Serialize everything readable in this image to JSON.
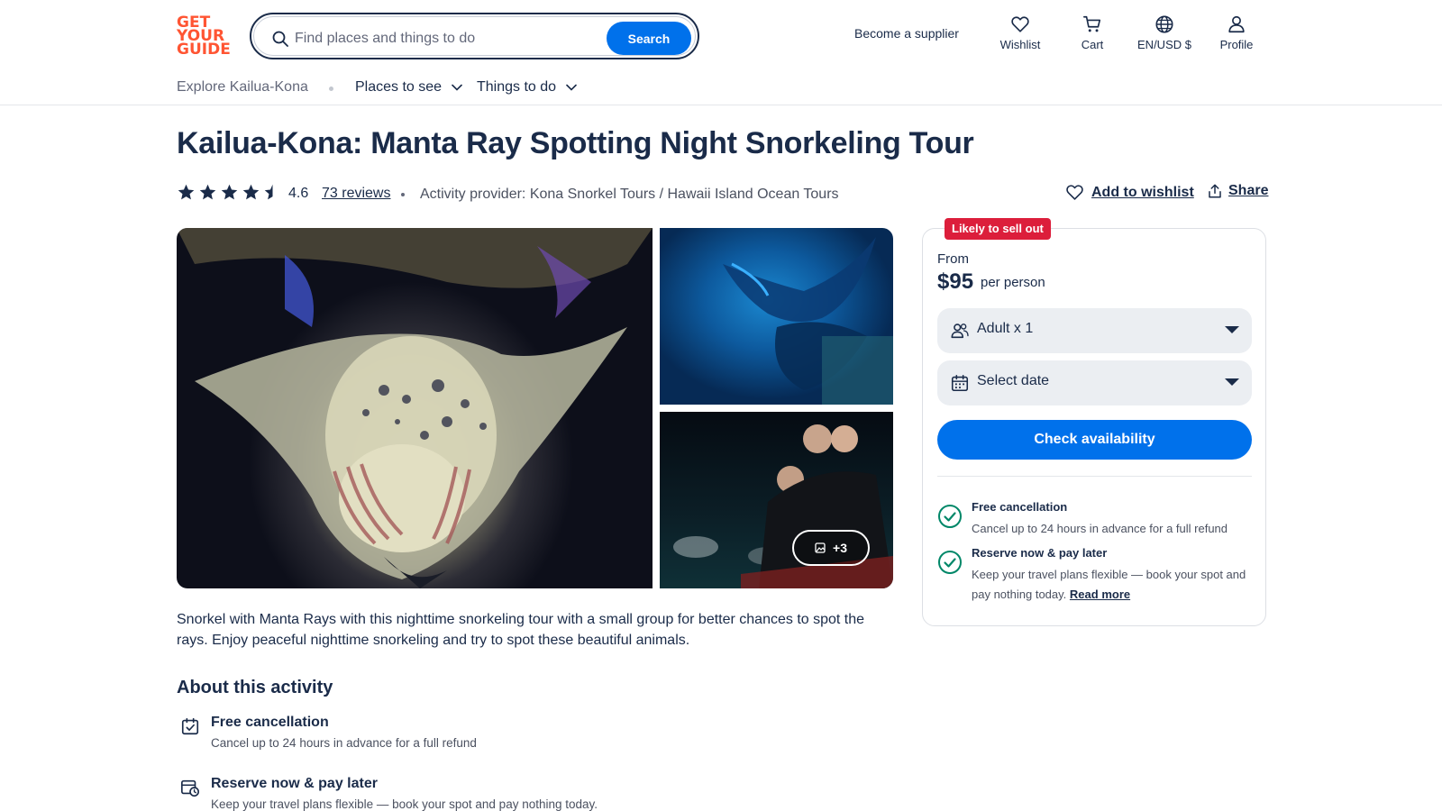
{
  "header": {
    "logo_lines": [
      "GET",
      "YOUR",
      "GUIDE"
    ],
    "search_placeholder": "Find places and things to do",
    "search_button": "Search",
    "become_supplier": "Become a supplier",
    "wishlist": "Wishlist",
    "cart": "Cart",
    "language": "EN/USD $",
    "profile": "Profile",
    "brand_color": "#ff5533",
    "accent_color": "#0071eb"
  },
  "subnav": {
    "explore": "Explore Kailua-Kona",
    "places": "Places to see",
    "things": "Things to do"
  },
  "activity": {
    "title": "Kailua-Kona: Manta Ray Spotting Night Snorkeling Tour",
    "rating": "4.6",
    "rating_stars": 4.6,
    "reviews": "73 reviews",
    "provider": "Activity provider: Kona Snorkel Tours / Hawaii Island Ocean Tours",
    "add_to_wishlist": "Add to wishlist",
    "share": "Share"
  },
  "gallery": {
    "more_count": "+3"
  },
  "description": "Snorkel with Manta Rays with this nighttime snorkeling tour with a small group for better chances to spot the rays. Enjoy peaceful nighttime snorkeling and try to spot these beautiful animals.",
  "about": {
    "title": "About this activity",
    "items": [
      {
        "heading": "Free cancellation",
        "text": "Cancel up to 24 hours in advance for a full refund"
      },
      {
        "heading": "Reserve now & pay later",
        "text": "Keep your travel plans flexible — book your spot and pay nothing today."
      }
    ]
  },
  "booking": {
    "badge": "Likely to sell out",
    "badge_color": "#dc1e3b",
    "from": "From",
    "price": "$95",
    "per_person": "per person",
    "participants": "Adult x 1",
    "date": "Select date",
    "check_availability": "Check availability",
    "benefits": [
      {
        "heading": "Free cancellation",
        "text": "Cancel up to 24 hours in advance for a full refund"
      },
      {
        "heading": "Reserve now & pay later",
        "text": "Keep your travel plans flexible — book your spot and pay nothing today.",
        "link": "Read more"
      }
    ]
  }
}
